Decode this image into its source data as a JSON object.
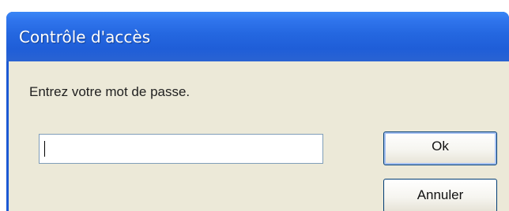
{
  "window": {
    "title": "Contrôle d'accès"
  },
  "dialog": {
    "prompt": "Entrez votre mot de passe.",
    "password_value": ""
  },
  "buttons": {
    "ok_label": "Ok",
    "cancel_label": "Annuler"
  },
  "colors": {
    "titlebar": "#2467e0",
    "dialog_background": "#ece9d8",
    "input_border": "#7f9db9",
    "button_border": "#003c74"
  }
}
